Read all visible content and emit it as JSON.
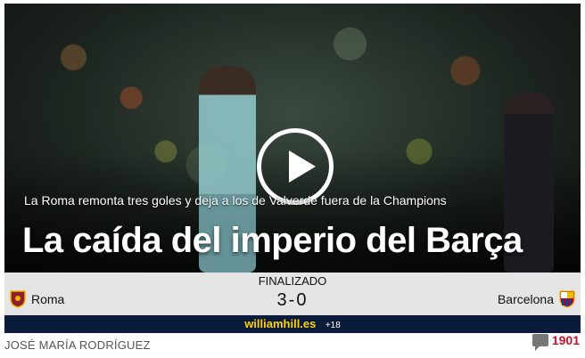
{
  "hero": {
    "subheadline": "La Roma remonta tres goles y deja a los de Valverde fuera de la Champions",
    "headline": "La caída del imperio del Barça",
    "play_icon": "play-icon"
  },
  "match": {
    "status": "FINALIZADO",
    "score": "3-0",
    "home_team": "Roma",
    "away_team": "Barcelona",
    "home_crest": "roma-crest-icon",
    "away_crest": "barcelona-crest-icon"
  },
  "sponsor": {
    "brand": "williamhill.es",
    "age_notice": "+18"
  },
  "article": {
    "author": "JOSÉ MARÍA RODRÍGUEZ",
    "comment_count": "1901",
    "comment_icon": "comment-icon"
  },
  "colors": {
    "scorebar_bg": "#e5e5e5",
    "sponsor_bg": "#0a1a3a",
    "sponsor_brand": "#ffd200",
    "comment_count": "#c8102e"
  }
}
